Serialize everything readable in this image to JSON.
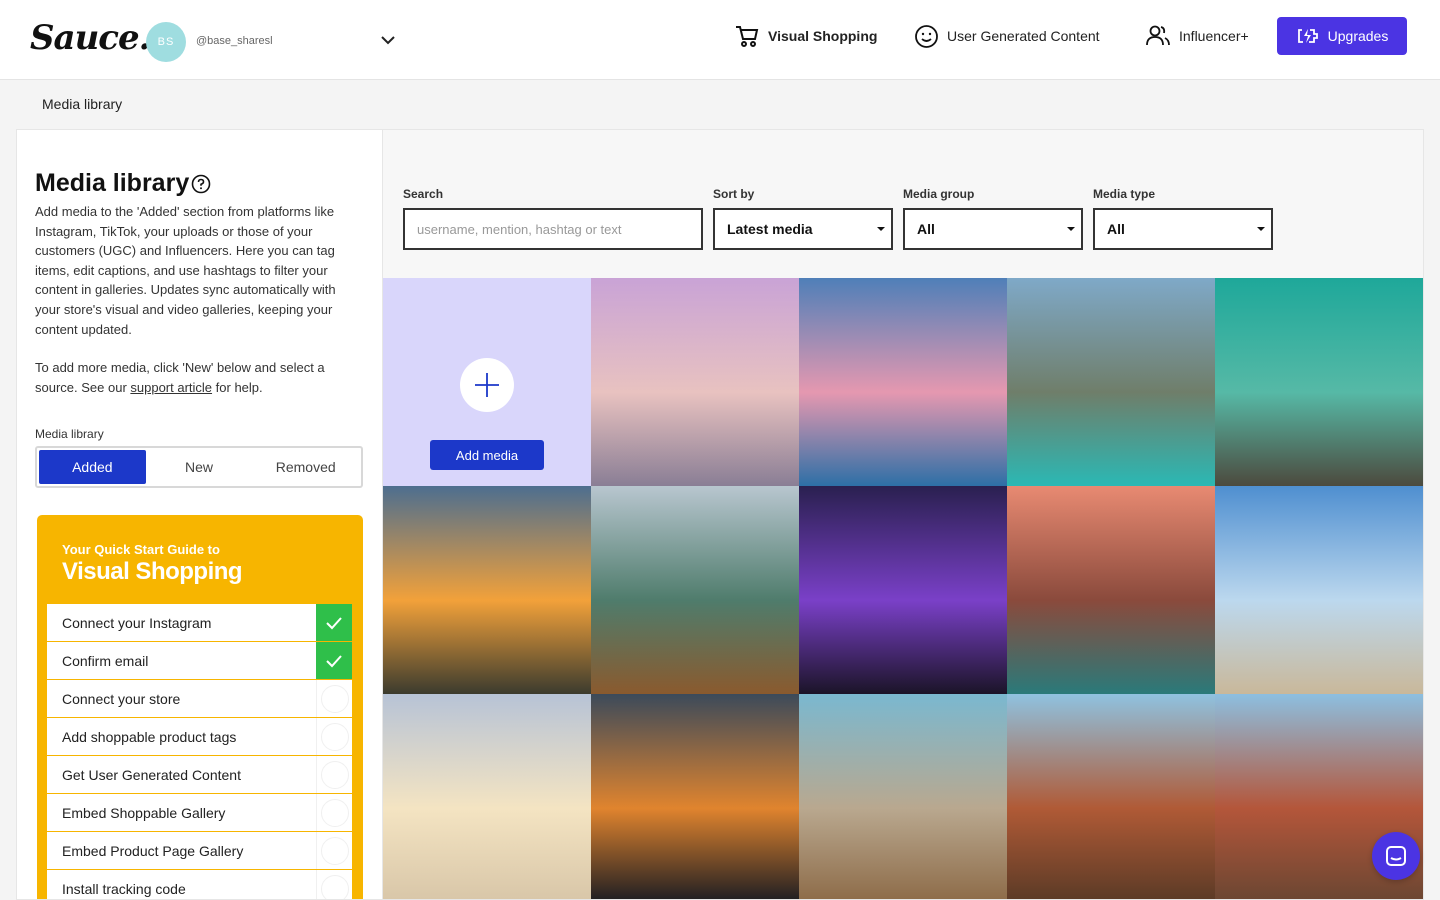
{
  "header": {
    "logo": "Sauce.",
    "account": {
      "initials": "BS",
      "handle": "@base_sharesl"
    },
    "nav": [
      {
        "label": "Visual Shopping",
        "icon": "cart-icon",
        "active": true
      },
      {
        "label": "User Generated Content",
        "icon": "smiley-icon",
        "active": false
      },
      {
        "label": "Influencer+",
        "icon": "users-icon",
        "active": false
      }
    ],
    "upgrade_label": "Upgrades"
  },
  "breadcrumb": "Media library",
  "left": {
    "title": "Media library",
    "description": "Add media to the 'Added' section from platforms like Instagram, TikTok, your uploads or those of your customers (UGC) and Influencers. Here you can tag items, edit captions, and use hashtags to filter your content in galleries. Updates sync automatically with your store's visual and video galleries, keeping your content updated.",
    "help_prefix": "To add more media, click 'New' below and select a source. See our ",
    "help_link": "support article",
    "help_suffix": " for help.",
    "segment_label": "Media library",
    "segments": [
      "Added",
      "New",
      "Removed"
    ],
    "active_segment": "Added",
    "guide": {
      "subtitle": "Your Quick Start Guide to",
      "title": "Visual Shopping",
      "steps": [
        {
          "label": "Connect your Instagram",
          "done": true
        },
        {
          "label": "Confirm email",
          "done": true
        },
        {
          "label": "Connect your store",
          "done": false
        },
        {
          "label": "Add shoppable product tags",
          "done": false
        },
        {
          "label": "Get User Generated Content",
          "done": false
        },
        {
          "label": "Embed Shoppable Gallery",
          "done": false
        },
        {
          "label": "Embed Product Page Gallery",
          "done": false
        },
        {
          "label": "Install tracking code",
          "done": false
        }
      ]
    }
  },
  "filters": {
    "search_label": "Search",
    "search_placeholder": "username, mention, hashtag or text",
    "sort_label": "Sort by",
    "sort_value": "Latest media",
    "group_label": "Media group",
    "group_value": "All",
    "type_label": "Media type",
    "type_value": "All"
  },
  "add_media_label": "Add media",
  "media": [
    {
      "name": "dubai-skyline",
      "colors": [
        "#c9a3d6",
        "#e8c2c0",
        "#8a7e95"
      ]
    },
    {
      "name": "ocean-sunset",
      "colors": [
        "#4f7fb8",
        "#e598b0",
        "#2d6fa6"
      ]
    },
    {
      "name": "lake-kayak",
      "colors": [
        "#7fa9c8",
        "#6f7e6a",
        "#2bb8b4"
      ]
    },
    {
      "name": "hot-air-balloons",
      "colors": [
        "#1ea89a",
        "#56b9a6",
        "#4c4a3e"
      ]
    },
    {
      "name": "traveler-sunset",
      "colors": [
        "#4d6e8f",
        "#f2a13a",
        "#3b3b2e"
      ]
    },
    {
      "name": "mountain-boat",
      "colors": [
        "#b8c6cf",
        "#4f7c6c",
        "#8a5a2e"
      ]
    },
    {
      "name": "concert-crowd",
      "colors": [
        "#2a2050",
        "#7a40c8",
        "#1b1428"
      ]
    },
    {
      "name": "mountain-lake-reflection",
      "colors": [
        "#e88a72",
        "#8a4a3c",
        "#2a7a7a"
      ]
    },
    {
      "name": "seagulls-beach",
      "colors": [
        "#4f8fd0",
        "#bcd8ee",
        "#c9b89a"
      ]
    },
    {
      "name": "beach-sunrise",
      "colors": [
        "#b7c3d6",
        "#f4e4c2",
        "#d8c6a8"
      ]
    },
    {
      "name": "airplane-wing-sunset",
      "colors": [
        "#3c4a5a",
        "#e0842e",
        "#1d1d22"
      ]
    },
    {
      "name": "sunglasses-sand",
      "colors": [
        "#7ab8d0",
        "#b9a88f",
        "#8d6b48"
      ]
    },
    {
      "name": "canyon-hiker",
      "colors": [
        "#8fc2e0",
        "#b05a36",
        "#5a3a26"
      ]
    },
    {
      "name": "van-desert-road",
      "colors": [
        "#8dbfe0",
        "#b4563a",
        "#6a4632"
      ]
    }
  ]
}
